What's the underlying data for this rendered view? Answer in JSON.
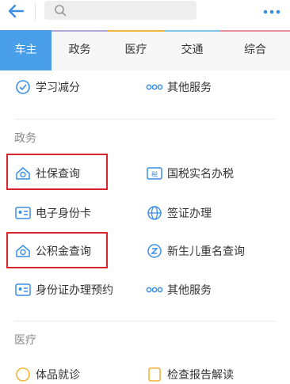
{
  "toolbar": {
    "back": "back-arrow",
    "search": "search-icon",
    "more": "more-dots"
  },
  "tabs": [
    {
      "label": "车主",
      "active": true,
      "color": "#4a9fea"
    },
    {
      "label": "政务",
      "active": false,
      "color": "#b3a5d8"
    },
    {
      "label": "医疗",
      "active": false,
      "color": "#f1b437"
    },
    {
      "label": "交通",
      "active": false,
      "color": "#7cc4ea"
    },
    {
      "label": "综合",
      "active": false,
      "color": "#e78f9d"
    }
  ],
  "rows": {
    "r0": {
      "left": "学习减分",
      "right": "其他服务"
    },
    "gov_title": "政务",
    "r1": {
      "left": "社保查询",
      "right": "国税实名办税"
    },
    "r2": {
      "left": "电子身份卡",
      "right": "签证办理"
    },
    "r3": {
      "left": "公积金查询",
      "right": "新生儿重名查询"
    },
    "r4": {
      "left": "身份证办理预约",
      "right": "其他服务"
    },
    "med_title": "医疗",
    "r5": {
      "left": "体品就诊",
      "right": "检查报告解读"
    }
  },
  "icon_badges": {
    "tax": "税"
  },
  "accent": "#4a9fea",
  "highlight": "#d9232e"
}
